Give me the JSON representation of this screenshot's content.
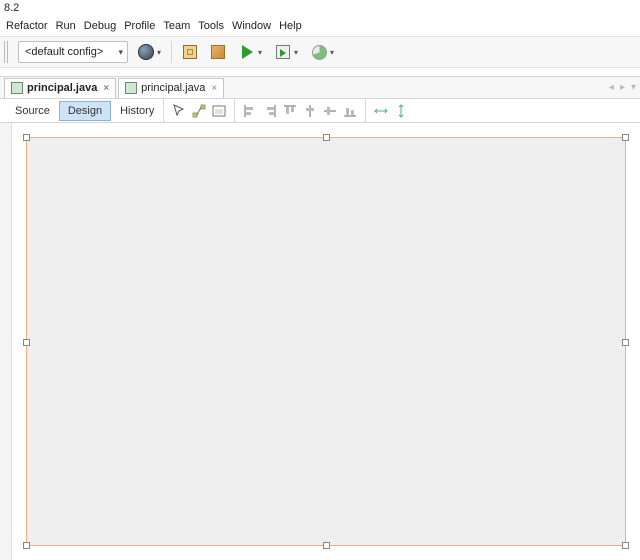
{
  "version": "8.2",
  "menu": {
    "refactor": "Refactor",
    "run": "Run",
    "debug": "Debug",
    "profile": "Profile",
    "team": "Team",
    "tools": "Tools",
    "window": "Window",
    "help": "Help"
  },
  "toolbar": {
    "config_combo": "<default config>"
  },
  "tabs": [
    {
      "label": "principal.java",
      "active": true
    },
    {
      "label": "principal.java",
      "active": false
    }
  ],
  "subtabs": {
    "source": "Source",
    "design": "Design",
    "history": "History"
  }
}
